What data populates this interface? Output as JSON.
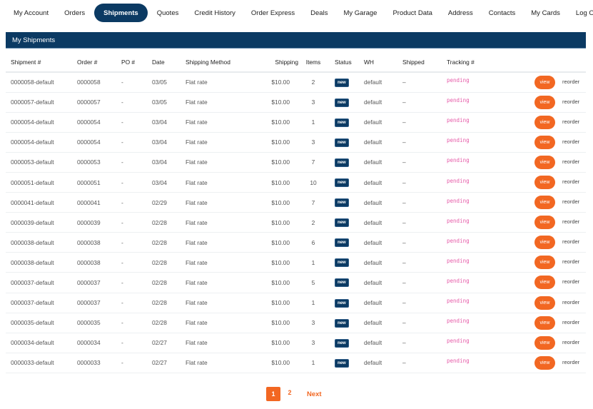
{
  "nav": {
    "items": [
      {
        "label": "My Account",
        "active": false
      },
      {
        "label": "Orders",
        "active": false
      },
      {
        "label": "Shipments",
        "active": true
      },
      {
        "label": "Quotes",
        "active": false
      },
      {
        "label": "Credit History",
        "active": false
      },
      {
        "label": "Order Express",
        "active": false
      },
      {
        "label": "Deals",
        "active": false
      },
      {
        "label": "My Garage",
        "active": false
      },
      {
        "label": "Product Data",
        "active": false
      },
      {
        "label": "Address",
        "active": false
      },
      {
        "label": "Contacts",
        "active": false
      },
      {
        "label": "My Cards",
        "active": false
      },
      {
        "label": "Log Out",
        "active": false
      }
    ]
  },
  "panel": {
    "title": "My Shipments"
  },
  "table": {
    "columns": [
      "Shipment #",
      "Order #",
      "PO #",
      "Date",
      "Shipping Method",
      "Shipping",
      "Items",
      "Status",
      "WH",
      "Shipped",
      "Tracking #",
      ""
    ],
    "view_label": "view",
    "reorder_label": "reorder",
    "rows": [
      {
        "shipment": "0000058-default",
        "order": "0000058",
        "po": "-",
        "date": "03/05",
        "method": "Flat rate",
        "shipping": "$10.00",
        "items": "2",
        "status": "new",
        "wh": "default",
        "shipped": "–",
        "tracking": "pending"
      },
      {
        "shipment": "0000057-default",
        "order": "0000057",
        "po": "-",
        "date": "03/05",
        "method": "Flat rate",
        "shipping": "$10.00",
        "items": "3",
        "status": "new",
        "wh": "default",
        "shipped": "–",
        "tracking": "pending"
      },
      {
        "shipment": "0000054-default",
        "order": "0000054",
        "po": "-",
        "date": "03/04",
        "method": "Flat rate",
        "shipping": "$10.00",
        "items": "1",
        "status": "new",
        "wh": "default",
        "shipped": "–",
        "tracking": "pending"
      },
      {
        "shipment": "0000054-default",
        "order": "0000054",
        "po": "-",
        "date": "03/04",
        "method": "Flat rate",
        "shipping": "$10.00",
        "items": "3",
        "status": "new",
        "wh": "default",
        "shipped": "–",
        "tracking": "pending"
      },
      {
        "shipment": "0000053-default",
        "order": "0000053",
        "po": "-",
        "date": "03/04",
        "method": "Flat rate",
        "shipping": "$10.00",
        "items": "7",
        "status": "new",
        "wh": "default",
        "shipped": "–",
        "tracking": "pending"
      },
      {
        "shipment": "0000051-default",
        "order": "0000051",
        "po": "-",
        "date": "03/04",
        "method": "Flat rate",
        "shipping": "$10.00",
        "items": "10",
        "status": "new",
        "wh": "default",
        "shipped": "–",
        "tracking": "pending"
      },
      {
        "shipment": "0000041-default",
        "order": "0000041",
        "po": "-",
        "date": "02/29",
        "method": "Flat rate",
        "shipping": "$10.00",
        "items": "7",
        "status": "new",
        "wh": "default",
        "shipped": "–",
        "tracking": "pending"
      },
      {
        "shipment": "0000039-default",
        "order": "0000039",
        "po": "-",
        "date": "02/28",
        "method": "Flat rate",
        "shipping": "$10.00",
        "items": "2",
        "status": "new",
        "wh": "default",
        "shipped": "–",
        "tracking": "pending"
      },
      {
        "shipment": "0000038-default",
        "order": "0000038",
        "po": "-",
        "date": "02/28",
        "method": "Flat rate",
        "shipping": "$10.00",
        "items": "6",
        "status": "new",
        "wh": "default",
        "shipped": "–",
        "tracking": "pending"
      },
      {
        "shipment": "0000038-default",
        "order": "0000038",
        "po": "-",
        "date": "02/28",
        "method": "Flat rate",
        "shipping": "$10.00",
        "items": "1",
        "status": "new",
        "wh": "default",
        "shipped": "–",
        "tracking": "pending"
      },
      {
        "shipment": "0000037-default",
        "order": "0000037",
        "po": "-",
        "date": "02/28",
        "method": "Flat rate",
        "shipping": "$10.00",
        "items": "5",
        "status": "new",
        "wh": "default",
        "shipped": "–",
        "tracking": "pending"
      },
      {
        "shipment": "0000037-default",
        "order": "0000037",
        "po": "-",
        "date": "02/28",
        "method": "Flat rate",
        "shipping": "$10.00",
        "items": "1",
        "status": "new",
        "wh": "default",
        "shipped": "–",
        "tracking": "pending"
      },
      {
        "shipment": "0000035-default",
        "order": "0000035",
        "po": "-",
        "date": "02/28",
        "method": "Flat rate",
        "shipping": "$10.00",
        "items": "3",
        "status": "new",
        "wh": "default",
        "shipped": "–",
        "tracking": "pending"
      },
      {
        "shipment": "0000034-default",
        "order": "0000034",
        "po": "-",
        "date": "02/27",
        "method": "Flat rate",
        "shipping": "$10.00",
        "items": "3",
        "status": "new",
        "wh": "default",
        "shipped": "–",
        "tracking": "pending"
      },
      {
        "shipment": "0000033-default",
        "order": "0000033",
        "po": "-",
        "date": "02/27",
        "method": "Flat rate",
        "shipping": "$10.00",
        "items": "1",
        "status": "new",
        "wh": "default",
        "shipped": "–",
        "tracking": "pending"
      }
    ]
  },
  "pagination": {
    "pages": [
      "1",
      "2"
    ],
    "current": "1",
    "next_label": "Next"
  },
  "colors": {
    "brand_navy": "#0b3a63",
    "accent_orange": "#f26722",
    "pending_pink": "#e65aa8"
  }
}
